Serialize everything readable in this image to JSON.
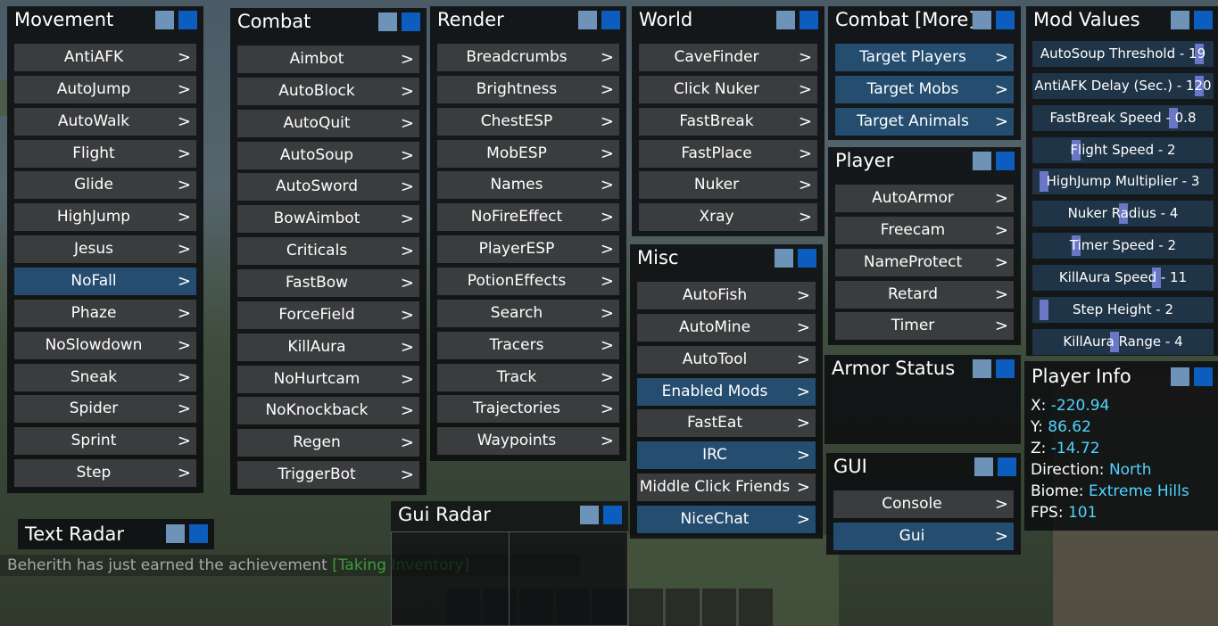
{
  "colors": {
    "toggle_light": "#6e93b8",
    "toggle_dark": "#0c5dbd",
    "enabled_row": "#244d6f",
    "value_text": "#4fd4ff"
  },
  "arrow": ">",
  "movement": {
    "title": "Movement",
    "items": [
      "AntiAFK",
      "AutoJump",
      "AutoWalk",
      "Flight",
      "Glide",
      "HighJump",
      "Jesus",
      "NoFall",
      "Phaze",
      "NoSlowdown",
      "Sneak",
      "Spider",
      "Sprint",
      "Step"
    ]
  },
  "combat": {
    "title": "Combat",
    "items": [
      "Aimbot",
      "AutoBlock",
      "AutoQuit",
      "AutoSoup",
      "AutoSword",
      "BowAimbot",
      "Criticals",
      "FastBow",
      "ForceField",
      "KillAura",
      "NoHurtcam",
      "NoKnockback",
      "Regen",
      "TriggerBot"
    ]
  },
  "render": {
    "title": "Render",
    "items": [
      "Breadcrumbs",
      "Brightness",
      "ChestESP",
      "MobESP",
      "Names",
      "NoFireEffect",
      "PlayerESP",
      "PotionEffects",
      "Search",
      "Tracers",
      "Track",
      "Trajectories",
      "Waypoints"
    ]
  },
  "world": {
    "title": "World",
    "items": [
      "CaveFinder",
      "Click Nuker",
      "FastBreak",
      "FastPlace",
      "Nuker",
      "Xray"
    ]
  },
  "misc": {
    "title": "Misc",
    "items": [
      "AutoFish",
      "AutoMine",
      "AutoTool",
      "Enabled Mods",
      "FastEat",
      "IRC",
      "Middle Click Friends",
      "NiceChat"
    ]
  },
  "combat_more": {
    "title": "Combat [More]",
    "items": [
      "Target Players",
      "Target Mobs",
      "Target Animals"
    ]
  },
  "player": {
    "title": "Player",
    "items": [
      "AutoArmor",
      "Freecam",
      "NameProtect",
      "Retard",
      "Timer"
    ]
  },
  "armor_status": {
    "title": "Armor Status"
  },
  "gui": {
    "title": "GUI",
    "items": [
      "Console",
      "Gui"
    ]
  },
  "gui_radar": {
    "title": "Gui Radar"
  },
  "text_radar": {
    "title": "Text Radar"
  },
  "mod_values": {
    "title": "Mod Values",
    "items": [
      {
        "label": "AutoSoup Threshold - 19",
        "fraction": 0.95
      },
      {
        "label": "AntiAFK Delay (Sec.) - 120",
        "fraction": 0.95
      },
      {
        "label": "FastBreak Speed - 0.8",
        "fraction": 0.8
      },
      {
        "label": "Flight Speed - 2",
        "fraction": 0.22
      },
      {
        "label": "HighJump Multiplier - 3",
        "fraction": 0.03
      },
      {
        "label": "Nuker Radius - 4",
        "fraction": 0.5
      },
      {
        "label": "Timer Speed - 2",
        "fraction": 0.22
      },
      {
        "label": "KillAura Speed - 11",
        "fraction": 0.7
      },
      {
        "label": "Step Height - 2",
        "fraction": 0.03
      },
      {
        "label": "KillAura Range - 4",
        "fraction": 0.45
      }
    ]
  },
  "player_info": {
    "title": "Player Info",
    "lines": [
      {
        "key": "X: ",
        "value": "-220.94"
      },
      {
        "key": "Y: ",
        "value": "86.62"
      },
      {
        "key": "Z: ",
        "value": "-14.72"
      },
      {
        "key": "Direction: ",
        "value": "North"
      },
      {
        "key": "Biome: ",
        "value": "Extreme Hills"
      },
      {
        "key": "FPS: ",
        "value": "101"
      }
    ]
  },
  "chat": {
    "message": "Beherith has just earned the achievement ",
    "achievement": "[Taking Inventory]"
  }
}
